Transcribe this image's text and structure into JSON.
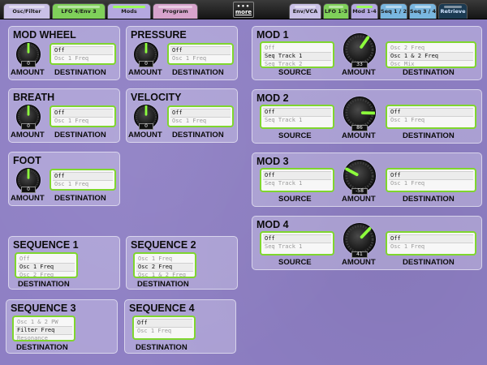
{
  "tabs": [
    {
      "label": "Osc/Filter",
      "color": "#c9c0e6"
    },
    {
      "label": "LFO 4/Env 3",
      "color": "#7fd05a"
    },
    {
      "label": "Mods",
      "color": "#b4a8e0"
    },
    {
      "label": "Program",
      "color": "#d7a3cc"
    },
    {
      "label": "Env/VCA",
      "color": "#c9c0e6"
    },
    {
      "label": "LFO 1-3",
      "color": "#7fd05a"
    },
    {
      "label": "Mod 1-4",
      "color": "#b4a8e0"
    },
    {
      "label": "Seq 1 / 2",
      "color": "#79b6e0"
    },
    {
      "label": "Seq 3 / 4",
      "color": "#79b6e0"
    },
    {
      "label": "Retrieve",
      "color": "#1b3a52"
    }
  ],
  "more": {
    "dots": "•••",
    "label": "more"
  },
  "labels": {
    "amount": "AMOUNT",
    "destination": "DESTINATION",
    "source": "SOURCE"
  },
  "panels": {
    "mod_wheel": {
      "title": "MOD WHEEL",
      "amount": "0",
      "dest": [
        "Off",
        "Osc 1 Freq"
      ]
    },
    "pressure": {
      "title": "PRESSURE",
      "amount": "0",
      "dest": [
        "Off",
        "Osc 1 Freq"
      ]
    },
    "breath": {
      "title": "BREATH",
      "amount": "0",
      "dest": [
        "Off",
        "Osc 1 Freq"
      ]
    },
    "velocity": {
      "title": "VELOCITY",
      "amount": "0",
      "dest": [
        "Off",
        "Osc 1 Freq"
      ]
    },
    "foot": {
      "title": "FOOT",
      "amount": "0",
      "dest": [
        "Off",
        "Osc 1 Freq"
      ]
    },
    "seq1": {
      "title": "SEQUENCE 1",
      "dest": [
        "Off",
        "Osc 1 Freq",
        "Osc 2 Freq"
      ]
    },
    "seq2": {
      "title": "SEQUENCE 2",
      "dest": [
        "Osc 1 Freq",
        "Osc 2 Freq",
        "Osc 1 & 2 Freq"
      ]
    },
    "seq3": {
      "title": "SEQUENCE 3",
      "dest": [
        "Osc 1 & 2 PW",
        "Filter Freq",
        "Resonance"
      ]
    },
    "seq4": {
      "title": "SEQUENCE 4",
      "dest": [
        "Off",
        "Osc 1 Freq"
      ]
    },
    "mod1": {
      "title": "MOD 1",
      "source": [
        "Off",
        "Seq Track 1",
        "Seq Track 2"
      ],
      "amount": "33",
      "dest": [
        "Osc 2 Freq",
        "Osc 1 & 2 Freq",
        "Osc Mix"
      ]
    },
    "mod2": {
      "title": "MOD 2",
      "source": [
        "Off",
        "Seq Track 1"
      ],
      "amount": "86",
      "dest": [
        "Off",
        "Osc 1 Freq"
      ]
    },
    "mod3": {
      "title": "MOD 3",
      "source": [
        "Off",
        "Seq Track 1"
      ],
      "amount": "-58",
      "dest": [
        "Off",
        "Osc 1 Freq"
      ]
    },
    "mod4": {
      "title": "MOD 4",
      "source": [
        "Off",
        "Seq Track 1"
      ],
      "amount": "41",
      "dest": [
        "Off",
        "Osc 1 Freq"
      ]
    }
  }
}
